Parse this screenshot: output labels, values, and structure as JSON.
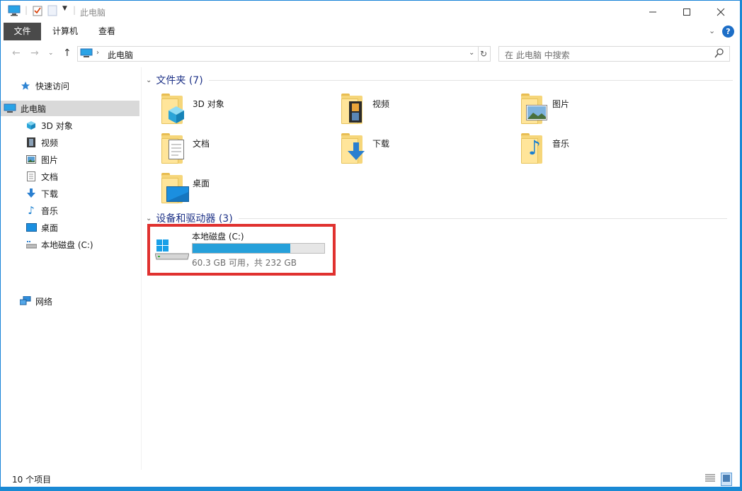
{
  "window": {
    "title": "此电脑",
    "minimize_label": "—",
    "maximize_label": "☐",
    "close_label": "✕"
  },
  "ribbon": {
    "tabs": [
      "文件",
      "计算机",
      "查看"
    ]
  },
  "address": {
    "location": "此电脑",
    "search_placeholder": "在 此电脑 中搜索"
  },
  "sidebar": {
    "quick_access": "快速访问",
    "this_pc": "此电脑",
    "items": [
      "3D 对象",
      "视频",
      "图片",
      "文档",
      "下载",
      "音乐",
      "桌面",
      "本地磁盘 (C:)"
    ],
    "network": "网络"
  },
  "folders_group": {
    "title": "文件夹 (7)",
    "items": [
      "3D 对象",
      "视频",
      "图片",
      "文档",
      "下载",
      "音乐",
      "桌面"
    ]
  },
  "devices_group": {
    "title": "设备和驱动器 (3)",
    "drive_name": "本地磁盘 (C:)",
    "drive_free": "60.3 GB 可用，共 232 GB",
    "used_fraction": 0.74
  },
  "status": {
    "item_count": "10 个项目"
  },
  "colors": {
    "accent": "#1a8ad3",
    "file_tab": "#4a4a4a",
    "group_title": "#1e3287",
    "drive_bar": "#26a0da",
    "highlight": "#e0312f",
    "selected_nav": "#d9d9d9"
  }
}
